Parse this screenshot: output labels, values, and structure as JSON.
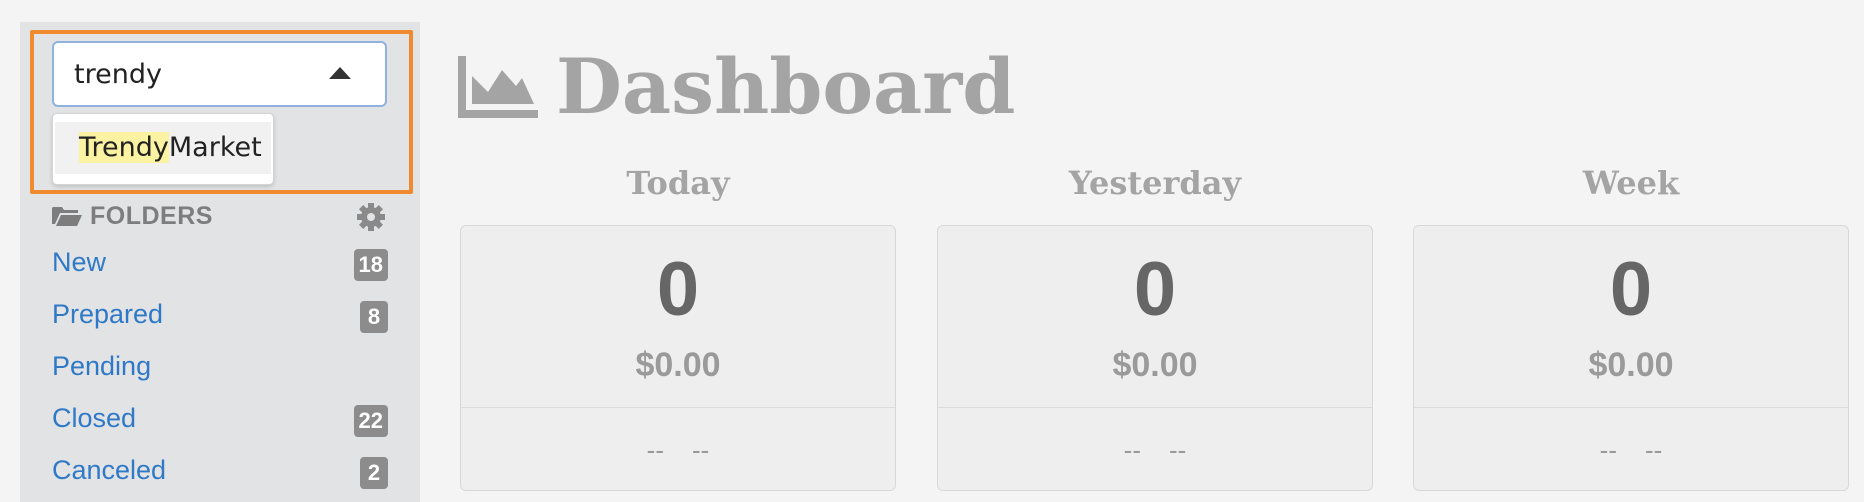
{
  "search": {
    "value": "trendy",
    "results": [
      {
        "match": "Trendy",
        "rest": "Market"
      }
    ]
  },
  "folders": {
    "title": "FOLDERS",
    "items": [
      {
        "label": "New",
        "count": "18"
      },
      {
        "label": "Prepared",
        "count": "8"
      },
      {
        "label": "Pending",
        "count": ""
      },
      {
        "label": "Closed",
        "count": "22"
      },
      {
        "label": "Canceled",
        "count": "2"
      }
    ]
  },
  "dashboard": {
    "title": "Dashboard",
    "periods": [
      {
        "label": "Today",
        "count": "0",
        "amount": "$0.00",
        "foot_left": "--",
        "foot_right": "--"
      },
      {
        "label": "Yesterday",
        "count": "0",
        "amount": "$0.00",
        "foot_left": "--",
        "foot_right": "--"
      },
      {
        "label": "Week",
        "count": "0",
        "amount": "$0.00",
        "foot_left": "--",
        "foot_right": "--"
      }
    ]
  },
  "colors": {
    "highlight_border": "#ef8a2f",
    "link": "#2f79c7",
    "match_highlight": "#fbf2a2"
  },
  "icons": {
    "folders": "folder-open-icon",
    "settings": "gear-icon",
    "dashboard": "area-chart-icon",
    "dropdown": "caret-up-icon"
  }
}
